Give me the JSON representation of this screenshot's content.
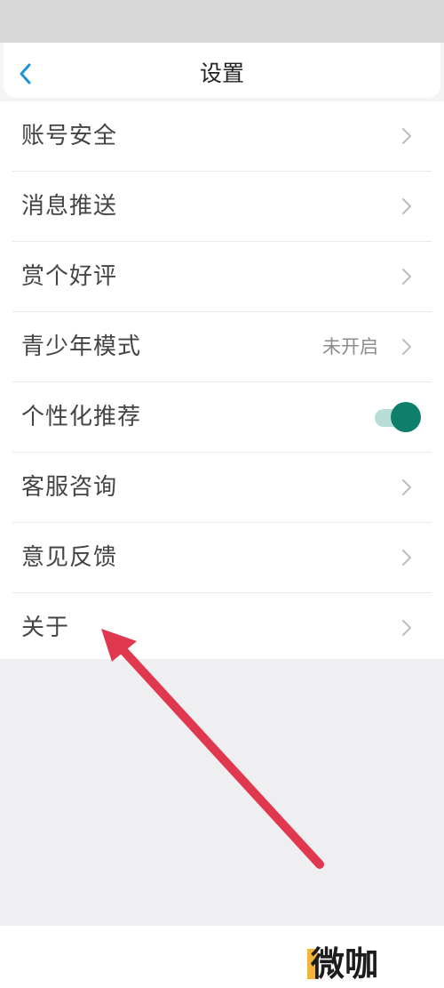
{
  "header": {
    "title": "设置",
    "back_icon": "chevron-left-icon"
  },
  "settings": {
    "items": [
      {
        "label": "账号安全",
        "trailing": "chevron"
      },
      {
        "label": "消息推送",
        "trailing": "chevron"
      },
      {
        "label": "赏个好评",
        "trailing": "chevron"
      },
      {
        "label": "青少年模式",
        "value": "未开启",
        "trailing": "chevron"
      },
      {
        "label": "个性化推荐",
        "trailing": "toggle",
        "toggle_on": true
      },
      {
        "label": "客服咨询",
        "trailing": "chevron"
      },
      {
        "label": "意见反馈",
        "trailing": "chevron"
      },
      {
        "label": "关于",
        "trailing": "chevron"
      }
    ]
  },
  "watermark": {
    "text": "微咖"
  },
  "colors": {
    "accent": "#1e90d8",
    "toggle_knob": "#0e7f6b",
    "toggle_track": "#b8dcd6",
    "annotation_arrow": "#e0384f"
  }
}
